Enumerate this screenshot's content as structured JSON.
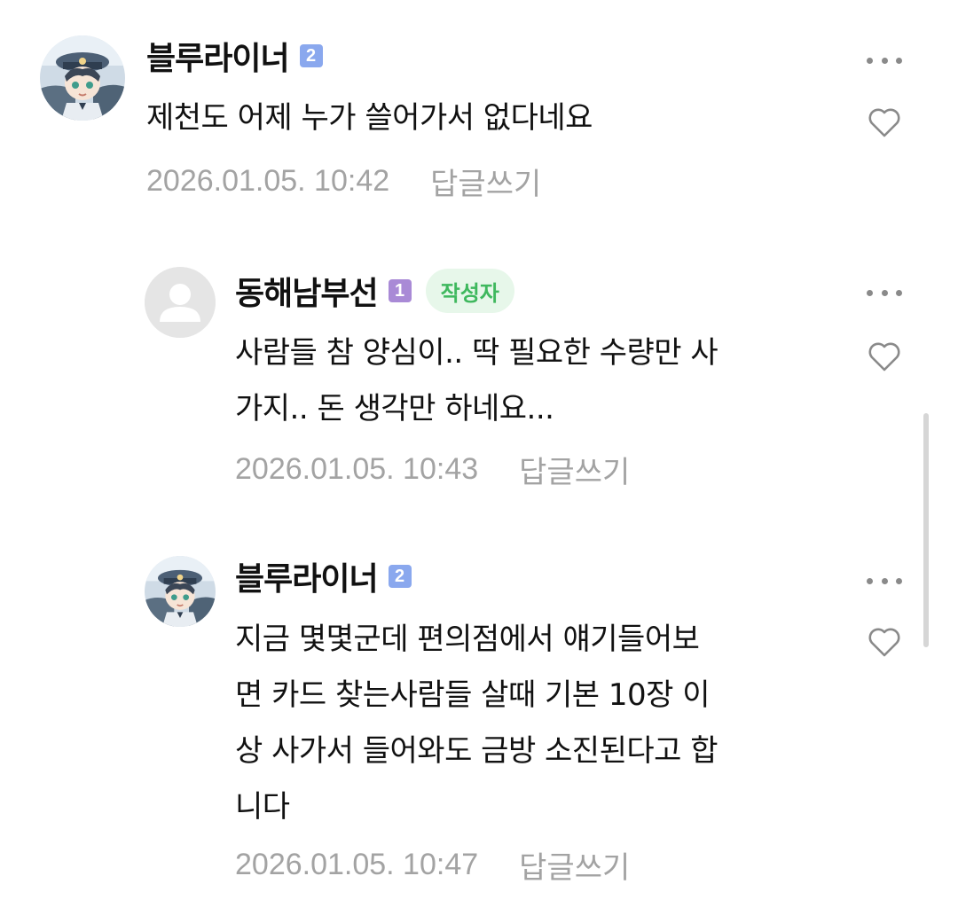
{
  "comments": [
    {
      "nickname": "블루라이너",
      "level": "2",
      "level_color": "#8aa8ee",
      "is_author": false,
      "avatar": "anime-avatar",
      "text": "제천도 어제 누가 쓸어가서 없다네요",
      "date": "2026.01.05. 10:42",
      "reply_label": "답글쓰기",
      "more_icon": "more-dots-icon",
      "like_icon": "heart-outline-icon"
    },
    {
      "nickname": "동해남부선",
      "level": "1",
      "level_color": "#a98ad6",
      "is_author": true,
      "author_badge": "작성자",
      "avatar": "default-user-avatar",
      "text": "사람들 참 양심이.. 딱 필요한 수량만 사\n가지.. 돈 생각만 하네요...",
      "date": "2026.01.05. 10:43",
      "reply_label": "답글쓰기",
      "more_icon": "more-dots-icon",
      "like_icon": "heart-outline-icon"
    },
    {
      "nickname": "블루라이너",
      "level": "2",
      "level_color": "#8aa8ee",
      "is_author": false,
      "avatar": "anime-avatar",
      "text": "지금 몇몇군데 편의점에서 얘기들어보\n면 카드 찾는사람들 살때 기본 10장 이\n상 사가서 들어와도 금방 소진된다고 합\n니다",
      "date": "2026.01.05. 10:47",
      "reply_label": "답글쓰기",
      "more_icon": "more-dots-icon",
      "like_icon": "heart-outline-icon"
    }
  ],
  "colors": {
    "text": "#111111",
    "meta": "#a3a3a3",
    "author_badge_bg": "#e7f7ea",
    "author_badge_text": "#3fb85e"
  }
}
